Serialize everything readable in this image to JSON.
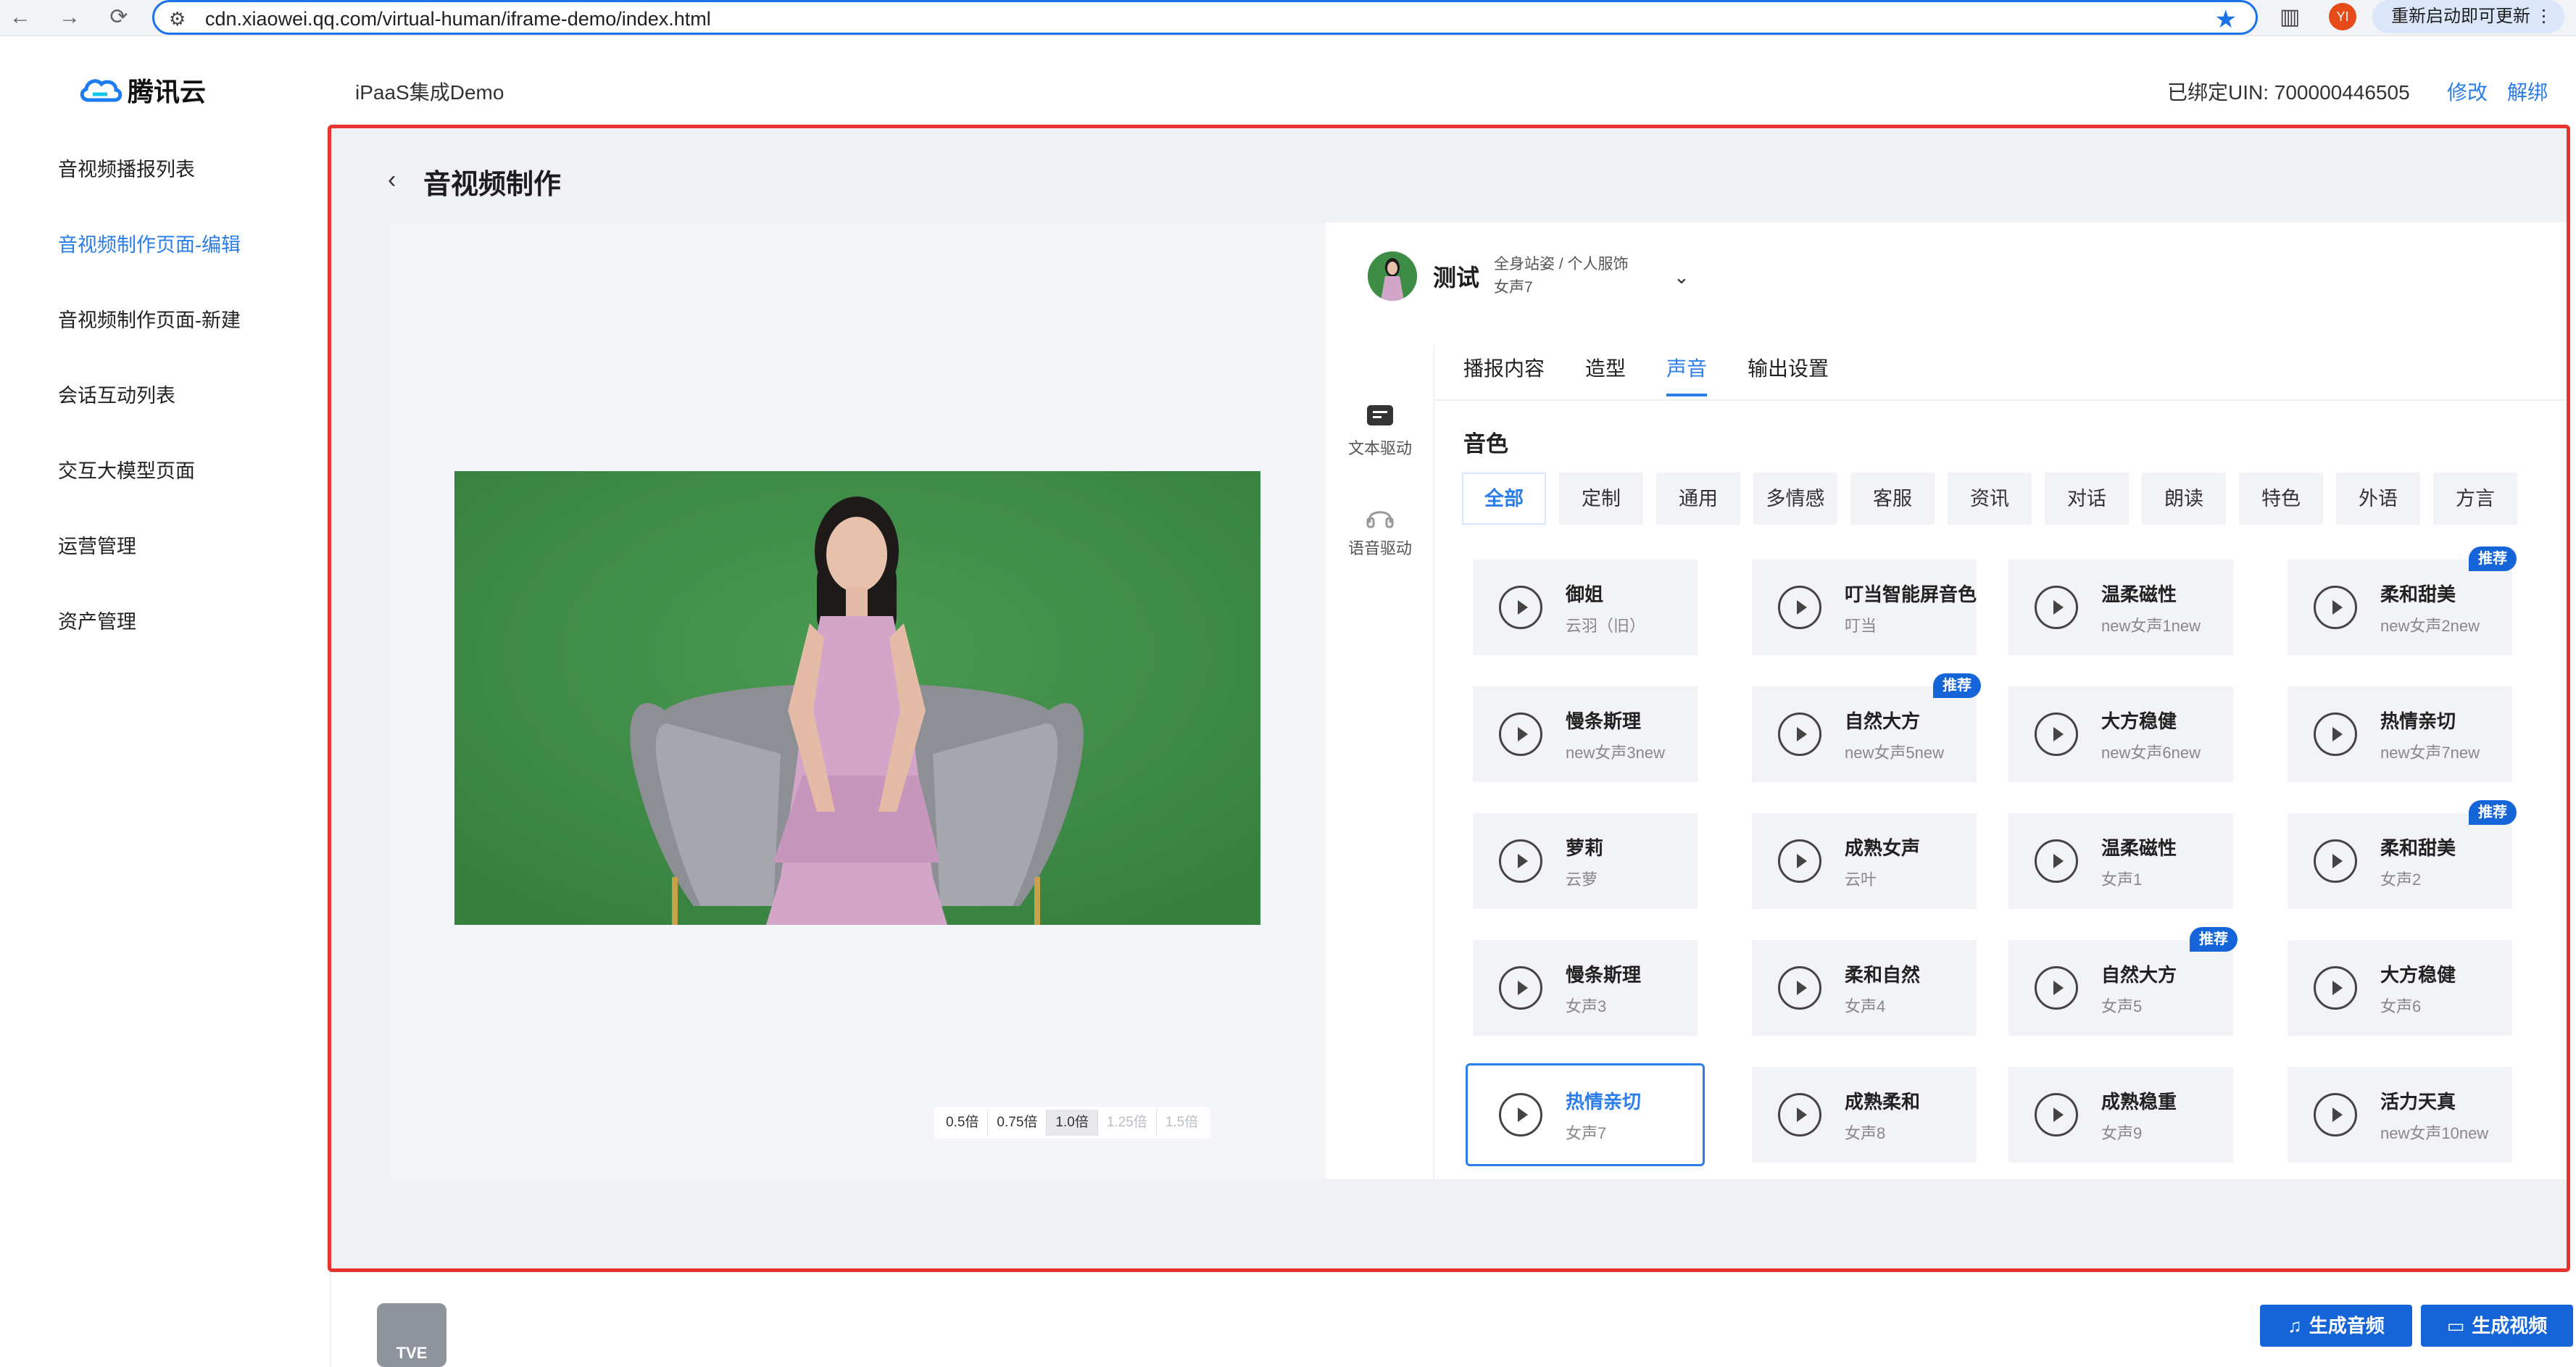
{
  "browser": {
    "url": "cdn.xiaowei.qq.com/virtual-human/iframe-demo/index.html",
    "update_label": "重新启动即可更新",
    "profile_initial": "YI"
  },
  "header": {
    "logo_text": "腾讯云",
    "app_title": "iPaaS集成Demo",
    "uin_text": "已绑定UIN: 700000446505",
    "edit_link": "修改",
    "unbind_link": "解绑"
  },
  "sidebar": {
    "items": [
      {
        "label": "音视频播报列表"
      },
      {
        "label": "音视频制作页面-编辑"
      },
      {
        "label": "音视频制作页面-新建"
      },
      {
        "label": "会话互动列表"
      },
      {
        "label": "交互大模型页面"
      },
      {
        "label": "运营管理"
      },
      {
        "label": "资产管理"
      }
    ]
  },
  "main": {
    "page_title": "音视频制作",
    "speeds": [
      "0.5倍",
      "0.75倍",
      "1.0倍",
      "1.25倍",
      "1.5倍"
    ],
    "avatar": {
      "name": "测试",
      "meta1": "全身站姿 / 个人服饰",
      "meta2": "女声7"
    },
    "tools": [
      {
        "label": "文本驱动"
      },
      {
        "label": "语音驱动"
      }
    ],
    "tabs": [
      "播报内容",
      "造型",
      "声音",
      "输出设置"
    ],
    "section_label": "音色",
    "categories": [
      "全部",
      "定制",
      "通用",
      "多情感",
      "客服",
      "资讯",
      "对话",
      "朗读",
      "特色",
      "外语",
      "方言"
    ],
    "badge_label": "推荐",
    "voices": [
      {
        "name": "御姐",
        "sub": "云羽（旧）"
      },
      {
        "name": "叮当智能屏音色",
        "sub": "叮当"
      },
      {
        "name": "温柔磁性",
        "sub": "new女声1new"
      },
      {
        "name": "柔和甜美",
        "sub": "new女声2new"
      },
      {
        "name": "慢条斯理",
        "sub": "new女声3new"
      },
      {
        "name": "自然大方",
        "sub": "new女声5new"
      },
      {
        "name": "大方稳健",
        "sub": "new女声6new"
      },
      {
        "name": "热情亲切",
        "sub": "new女声7new"
      },
      {
        "name": "萝莉",
        "sub": "云萝"
      },
      {
        "name": "成熟女声",
        "sub": "云叶"
      },
      {
        "name": "温柔磁性",
        "sub": "女声1"
      },
      {
        "name": "柔和甜美",
        "sub": "女声2"
      },
      {
        "name": "慢条斯理",
        "sub": "女声3"
      },
      {
        "name": "柔和自然",
        "sub": "女声4"
      },
      {
        "name": "自然大方",
        "sub": "女声5"
      },
      {
        "name": "大方稳健",
        "sub": "女声6"
      },
      {
        "name": "热情亲切",
        "sub": "女声7"
      },
      {
        "name": "成熟柔和",
        "sub": "女声8"
      },
      {
        "name": "成熟稳重",
        "sub": "女声9"
      },
      {
        "name": "活力天真",
        "sub": "new女声10new"
      }
    ]
  },
  "footer": {
    "logo_text": "TVE",
    "gen_audio": "生成音频",
    "gen_video": "生成视频"
  },
  "colors": {
    "accent": "#2b7de9",
    "frame_border": "#e8342e",
    "badge": "#1565d8",
    "green_screen": "#3d8a45"
  }
}
